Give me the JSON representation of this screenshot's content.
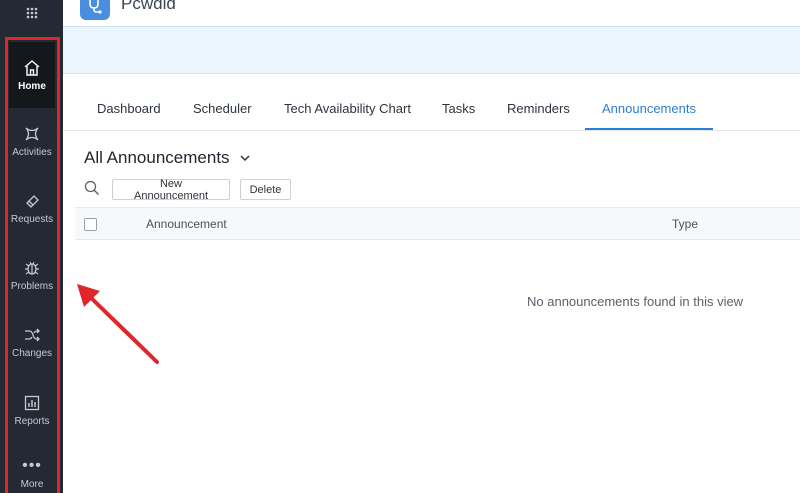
{
  "header": {
    "brand": "Pcwdld"
  },
  "sidebar": {
    "items": [
      {
        "label": "Home",
        "icon": "home-icon"
      },
      {
        "label": "Activities",
        "icon": "activities-icon"
      },
      {
        "label": "Requests",
        "icon": "requests-icon"
      },
      {
        "label": "Problems",
        "icon": "bug-icon"
      },
      {
        "label": "Changes",
        "icon": "shuffle-icon"
      },
      {
        "label": "Reports",
        "icon": "bar-chart-icon"
      },
      {
        "label": "More",
        "icon": "more-dots-icon"
      }
    ]
  },
  "tabs": [
    {
      "label": "Dashboard"
    },
    {
      "label": "Scheduler"
    },
    {
      "label": "Tech Availability Chart"
    },
    {
      "label": "Tasks"
    },
    {
      "label": "Reminders"
    },
    {
      "label": "Announcements"
    }
  ],
  "view": {
    "title": "All Announcements"
  },
  "toolbar": {
    "new_label": "New Announcement",
    "delete_label": "Delete"
  },
  "table": {
    "columns": [
      "Announcement",
      "Type"
    ],
    "empty_text": "No announcements found in this view"
  },
  "colors": {
    "accent": "#2b7fd3",
    "sidebar": "#232a33",
    "annotation": "#e0252b",
    "banner": "#ebf5fd"
  }
}
